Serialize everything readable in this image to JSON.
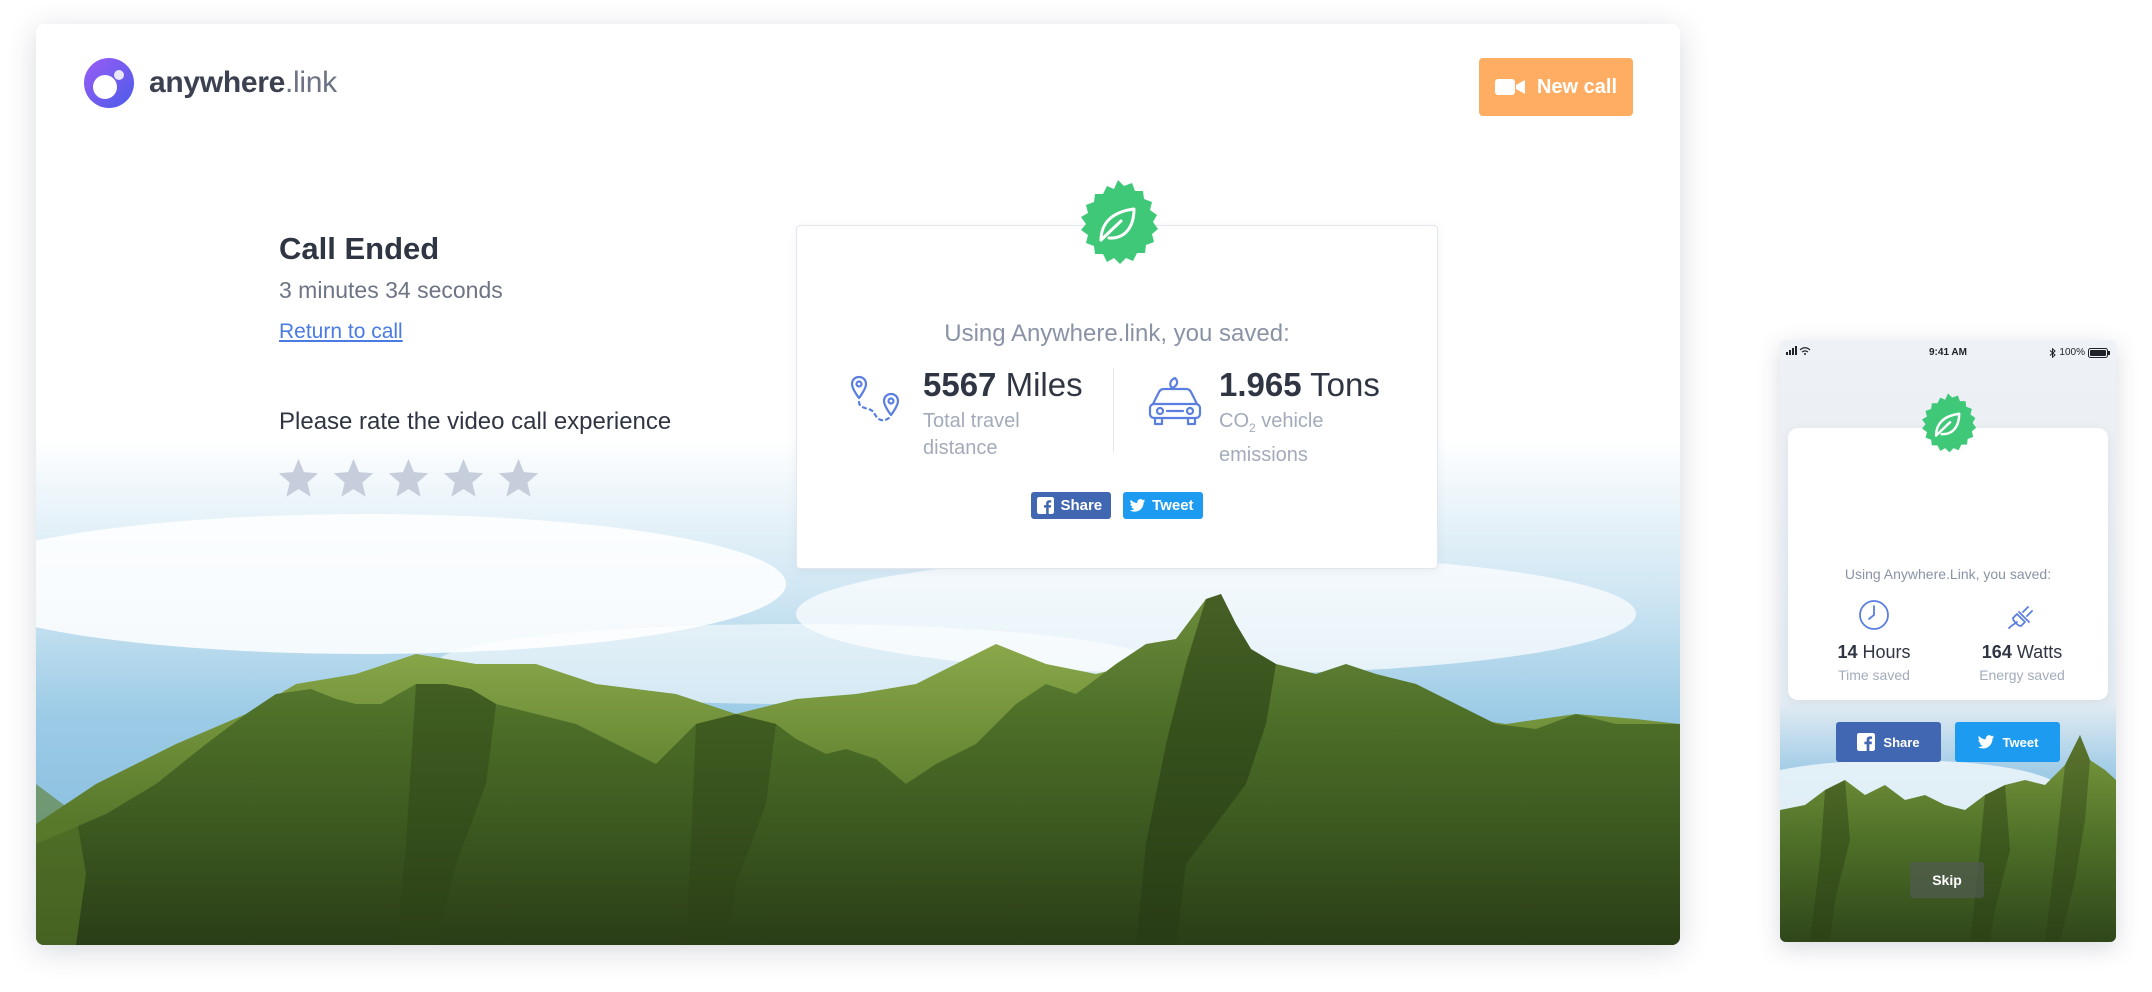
{
  "brand": {
    "name_bold": "anywhere",
    "name_rest": ".link"
  },
  "header": {
    "new_call_label": "New call",
    "new_call_icon": "video-camera-icon"
  },
  "call": {
    "status": "Call Ended",
    "duration": "3 minutes 34 seconds",
    "return_link": "Return to call"
  },
  "rating": {
    "prompt": "Please rate the video call experience",
    "max_stars": 5,
    "selected": 0
  },
  "savings": {
    "title": "Using Anywhere.link, you saved:",
    "stats": [
      {
        "icon": "route-pin-icon",
        "value": "5567",
        "unit": "Miles",
        "label": "Total travel distance"
      },
      {
        "icon": "car-icon",
        "value": "1.965",
        "unit": "Tons",
        "label_prefix": "CO",
        "label_sub": "2",
        "label_suffix": " vehicle emissions"
      }
    ],
    "share_label": "Share",
    "tweet_label": "Tweet"
  },
  "mobile": {
    "status_bar": {
      "time": "9:41 AM",
      "battery": "100%"
    },
    "title": "Using Anywhere.Link, you saved:",
    "stats": [
      {
        "icon": "clock-icon",
        "value": "14",
        "unit": "Hours",
        "label": "Time saved"
      },
      {
        "icon": "plug-icon",
        "value": "164",
        "unit": "Watts",
        "label": "Energy saved"
      }
    ],
    "share_label": "Share",
    "tweet_label": "Tweet",
    "skip_label": "Skip"
  },
  "colors": {
    "accent_orange": "#ffad62",
    "badge_green": "#3ec878",
    "link_blue": "#4a7be3",
    "facebook_blue": "#4267b2",
    "twitter_blue": "#1d9bf0",
    "star_gray": "#c6cddb"
  }
}
